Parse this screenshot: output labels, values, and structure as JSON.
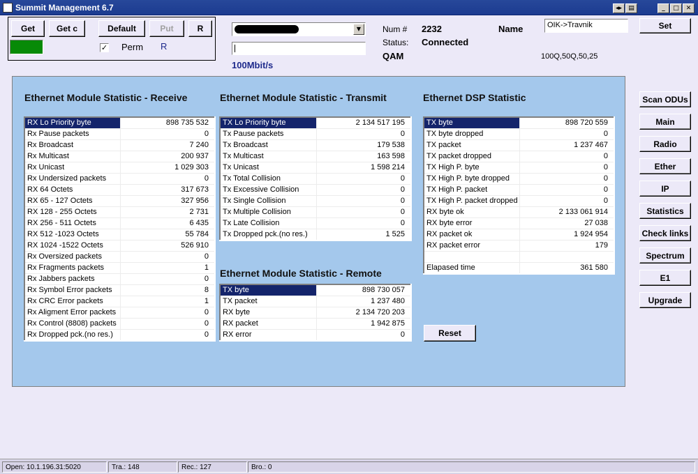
{
  "window": {
    "title": "Summit Management 6.7",
    "controls": {
      "restore_alt": "◂▸",
      "sysmenu": "▤",
      "minimize": "_",
      "maximize": "□",
      "close": "✕"
    }
  },
  "toolbar": {
    "get_label": "Get",
    "getc_label": "Get c",
    "default_label": "Default",
    "put_label": "Put",
    "r_button_label": "R",
    "perm_label": "Perm",
    "perm_checked": "✓",
    "r_indicator": "R",
    "indicator_color": "#078a07"
  },
  "combo": {
    "value": "",
    "arrow": "▼"
  },
  "speed": "100Mbit/s",
  "info": {
    "num_label": "Num #",
    "num_value": "2232",
    "status_label": "Status:",
    "status_value": "Connected",
    "modulation": "QAM",
    "name_label": "Name",
    "name_value": "OIK->Travnik",
    "set_label": "Set",
    "profile": "100Q,50Q,50,25"
  },
  "sections": {
    "receive_title": "Ethernet Module Statistic - Receive",
    "transmit_title": "Ethernet  Module Statistic - Transmit",
    "dsp_title": "Ethernet DSP   Statistic",
    "remote_title": "Ethernet  Module Statistic - Remote"
  },
  "receive_rows": [
    {
      "label": "RX Lo Priority byte",
      "value": "898 735 532"
    },
    {
      "label": "Rx Pause packets",
      "value": "0"
    },
    {
      "label": "Rx Broadcast",
      "value": "7 240"
    },
    {
      "label": "Rx Multicast",
      "value": "200 937"
    },
    {
      "label": "Rx Unicast",
      "value": "1 029 303"
    },
    {
      "label": "Rx Undersized packets",
      "value": "0"
    },
    {
      "label": "RX   64       Octets",
      "value": "317 673"
    },
    {
      "label": "RX   65 - 127  Octets",
      "value": "327 956"
    },
    {
      "label": "RX  128 - 255  Octets",
      "value": "2 731"
    },
    {
      "label": "RX  256 - 511  Octets",
      "value": "6 435"
    },
    {
      "label": "RX  512 -1023  Octets",
      "value": "55 784"
    },
    {
      "label": "RX 1024 -1522  Octets",
      "value": "526 910"
    },
    {
      "label": "Rx Oversized packets",
      "value": "0"
    },
    {
      "label": "Rx Fragments packets",
      "value": "1"
    },
    {
      "label": "Rx Jabbers packets",
      "value": "0"
    },
    {
      "label": "Rx Symbol Error packets",
      "value": "8"
    },
    {
      "label": "Rx CRC Error packets",
      "value": "1"
    },
    {
      "label": "Rx Aligment Error packets",
      "value": "0"
    },
    {
      "label": "Rx Control (8808) packets",
      "value": "0"
    },
    {
      "label": "Rx Dropped pck.(no res.)",
      "value": "0"
    }
  ],
  "transmit_rows": [
    {
      "label": "TX Lo Priority byte",
      "value": "2 134 517 195"
    },
    {
      "label": "Tx Pause packets",
      "value": "0"
    },
    {
      "label": "Tx Broadcast",
      "value": "179 538"
    },
    {
      "label": "Tx Multicast",
      "value": "163 598"
    },
    {
      "label": "Tx Unicast",
      "value": "1 598 214"
    },
    {
      "label": "Tx Total Collision",
      "value": "0"
    },
    {
      "label": "Tx Excessive Collision",
      "value": "0"
    },
    {
      "label": "Tx Single Collision",
      "value": "0"
    },
    {
      "label": "Tx Multiple Collision",
      "value": "0"
    },
    {
      "label": "Tx Late Collision",
      "value": "0"
    },
    {
      "label": "Tx Dropped pck.(no res.)",
      "value": "1 525"
    }
  ],
  "remote_rows": [
    {
      "label": "TX byte",
      "value": "898 730 057"
    },
    {
      "label": "TX packet",
      "value": "1 237 480"
    },
    {
      "label": "RX byte",
      "value": "2 134 720 203"
    },
    {
      "label": "RX packet",
      "value": "1 942 875"
    },
    {
      "label": "RX error",
      "value": "0"
    }
  ],
  "dsp_rows": [
    {
      "label": "TX byte",
      "value": "898 720 559"
    },
    {
      "label": "TX byte dropped",
      "value": "0"
    },
    {
      "label": "TX packet",
      "value": "1 237 467"
    },
    {
      "label": "TX packet dropped",
      "value": "0"
    },
    {
      "label": "TX High P. byte",
      "value": "0"
    },
    {
      "label": "TX High P. byte dropped",
      "value": "0"
    },
    {
      "label": "TX High P. packet",
      "value": "0"
    },
    {
      "label": "TX High P. packet dropped",
      "value": "0"
    },
    {
      "label": "RX byte ok",
      "value": "2 133 061 914"
    },
    {
      "label": "RX byte error",
      "value": "27 038"
    },
    {
      "label": "RX packet ok",
      "value": "1 924 954"
    },
    {
      "label": "RX packet error",
      "value": "179"
    },
    {
      "label": "",
      "value": ""
    },
    {
      "label": "Elapased time",
      "value": "361 580"
    }
  ],
  "reset_label": "Reset",
  "nav": {
    "scan_odus": "Scan ODUs",
    "main": "Main",
    "radio": "Radio",
    "ether": "Ether",
    "ip": "IP",
    "statistics": "Statistics",
    "check_links": "Check links",
    "spectrum": "Spectrum",
    "e1": "E1",
    "upgrade": "Upgrade"
  },
  "statusbar": {
    "open": "Open: 10.1.196.31:5020",
    "tra": "Tra.: 148",
    "rec": "Rec.: 127",
    "bro": "Bro.: 0"
  }
}
